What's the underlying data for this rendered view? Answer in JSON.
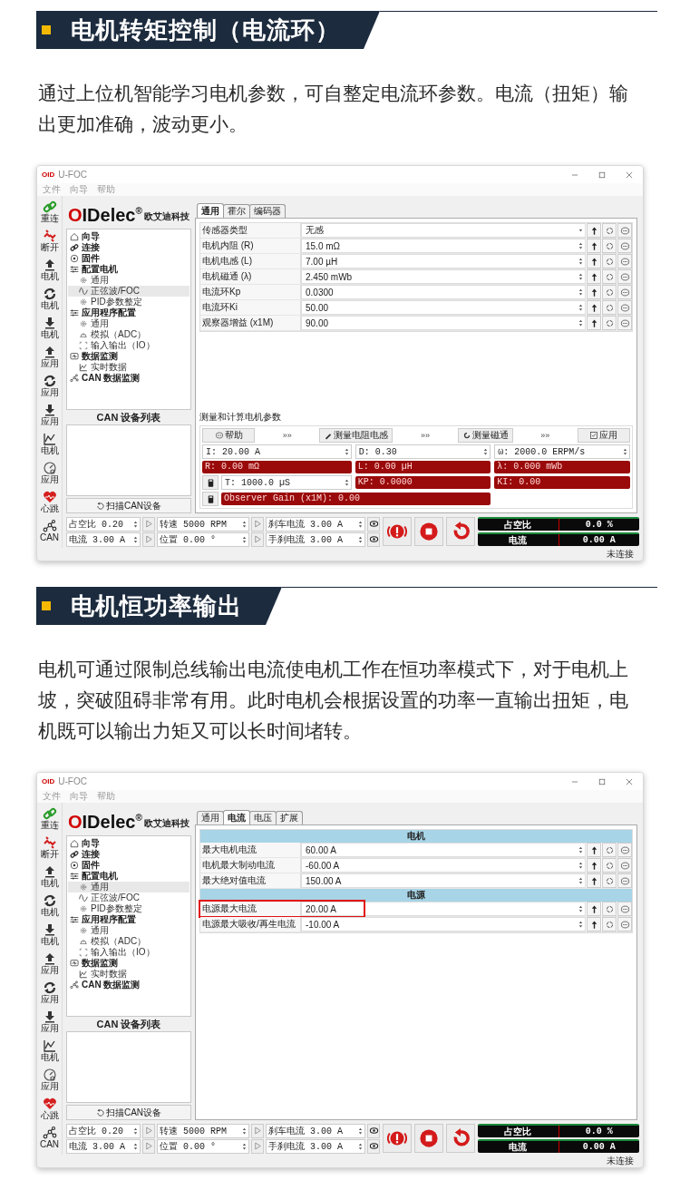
{
  "sections": [
    {
      "title": "电机转矩控制（电流环）",
      "paragraph": "通过上位机智能学习电机参数，可自整定电流环参数。电流（扭矩）输出更加准确，波动更小。",
      "app": {
        "badge": "OID",
        "title": "U-FOC",
        "menu": [
          "文件",
          "向导",
          "帮助"
        ],
        "toolbar": [
          {
            "kind": "connect",
            "label": "重连"
          },
          {
            "kind": "disconnect",
            "label": "断开"
          },
          {
            "kind": "upload",
            "label": "电机"
          },
          {
            "kind": "sync",
            "label": "电机"
          },
          {
            "kind": "download",
            "label": "电机"
          },
          {
            "kind": "upload",
            "label": "应用"
          },
          {
            "kind": "sync",
            "label": "应用"
          },
          {
            "kind": "download",
            "label": "应用"
          },
          {
            "kind": "chart",
            "label": "电机"
          },
          {
            "kind": "gauge",
            "label": "应用"
          },
          {
            "kind": "heart",
            "label": "心跳"
          },
          {
            "kind": "can",
            "label": "CAN"
          }
        ],
        "logo": {
          "accent": "O",
          "text": "IDelec",
          "mark": "®",
          "company": "欧艾迪科技"
        },
        "tree": [
          {
            "kind": "home",
            "label": "向导",
            "selected": false
          },
          {
            "kind": "link",
            "label": "连接",
            "selected": false
          },
          {
            "kind": "chip",
            "label": "固件",
            "selected": false
          },
          {
            "kind": "sliders",
            "label": "配置电机",
            "selected": false,
            "children": [
              {
                "kind": "gear",
                "label": "通用",
                "selected": false
              },
              {
                "kind": "wave",
                "label": "正弦波/FOC",
                "selected": true
              },
              {
                "kind": "pid",
                "label": "PID参数整定",
                "selected": false
              }
            ]
          },
          {
            "kind": "sliders",
            "label": "应用程序配置",
            "selected": false,
            "children": [
              {
                "kind": "gear",
                "label": "通用",
                "selected": false
              },
              {
                "kind": "analog",
                "label": "模拟（ADC）",
                "selected": false
              },
              {
                "kind": "io",
                "label": "输入输出（IO）",
                "selected": false
              }
            ]
          },
          {
            "kind": "monitor",
            "label": "数据监测",
            "selected": false,
            "children": [
              {
                "kind": "chart",
                "label": "实时数据",
                "selected": false
              }
            ]
          },
          {
            "kind": "can",
            "label": "CAN 数据监测",
            "selected": false
          }
        ],
        "can_list_title": "CAN 设备列表",
        "scan_button": "扫描CAN设备",
        "tabs": [
          {
            "label": "通用",
            "selected": true
          },
          {
            "label": "霍尔",
            "selected": false
          },
          {
            "label": "编码器",
            "selected": false
          }
        ],
        "rows": [
          {
            "kind": "dropdown",
            "label": "传感器类型",
            "value": "无感",
            "highlighted": false
          },
          {
            "kind": "spin",
            "label": "电机内阻 (R)",
            "value": "15.0 mΩ",
            "highlighted": false
          },
          {
            "kind": "spin",
            "label": "电机电感 (L)",
            "value": "7.00 µH",
            "highlighted": false
          },
          {
            "kind": "spin",
            "label": "电机磁通 (λ)",
            "value": "2.450 mWb",
            "highlighted": false
          },
          {
            "kind": "spin",
            "label": "电流环Kp",
            "value": "0.0300",
            "highlighted": false
          },
          {
            "kind": "spin",
            "label": "电流环Ki",
            "value": "50.00",
            "highlighted": false
          },
          {
            "kind": "spin",
            "label": "观察器增益 (x1M)",
            "value": "90.00",
            "highlighted": false
          }
        ],
        "measure": {
          "title": "测量和计算电机参数",
          "actions": [
            {
              "kind": "help",
              "label": "帮助"
            },
            {
              "kind": "arrow",
              "label": "»»"
            },
            {
              "kind": "measure_rl",
              "label": "测量电阻电感"
            },
            {
              "kind": "arrow",
              "label": "»»"
            },
            {
              "kind": "measure_flux",
              "label": "测量磁通"
            },
            {
              "kind": "arrow",
              "label": "»»"
            },
            {
              "kind": "apply",
              "label": "应用"
            }
          ],
          "rows": [
            [
              {
                "kind": "input",
                "text": "I: 20.00 A"
              },
              {
                "kind": "input",
                "text": "D: 0.30"
              },
              {
                "kind": "input",
                "text": "ω: 2000.0 ERPM/s"
              }
            ],
            [
              {
                "kind": "result",
                "text": "R: 0.00 mΩ"
              },
              {
                "kind": "result",
                "text": "L: 0.00 µH"
              },
              {
                "kind": "result",
                "text": "λ: 0.000 mWb"
              }
            ],
            [
              {
                "kind": "input",
                "text": "T: 1000.0 µS",
                "calculator": true
              },
              {
                "kind": "result",
                "text": "KP: 0.0000"
              },
              {
                "kind": "result",
                "text": "KI: 0.00"
              }
            ],
            [
              {
                "kind": "result",
                "text": "Observer Gain (x1M): 0.00",
                "calculator": true
              }
            ]
          ]
        },
        "controls": [
          {
            "text": "占空比 0.20",
            "kind": "play"
          },
          {
            "text": "转速 5000 RPM",
            "kind": "play"
          },
          {
            "text": "刹车电流 3.00 A",
            "kind": "view"
          },
          {
            "text": "电流 3.00 A",
            "kind": "play"
          },
          {
            "text": "位置 0.00 °",
            "kind": "play"
          },
          {
            "text": "手刹电流 3.00 A",
            "kind": "view"
          }
        ],
        "big_buttons": [
          {
            "kind": "alarm"
          },
          {
            "kind": "stop"
          },
          {
            "kind": "reset"
          }
        ],
        "meters": [
          {
            "label": "占空比",
            "reading": "0.0 %"
          },
          {
            "label": "电流",
            "reading": "0.00 A"
          }
        ],
        "status": "未连接"
      }
    },
    {
      "title": "电机恒功率输出",
      "paragraph": "电机可通过限制总线输出电流使电机工作在恒功率模式下，对于电机上坡，突破阻碍非常有用。此时电机会根据设置的功率一直输出扭矩，电机既可以输出力矩又可以长时间堵转。",
      "app": {
        "badge": "OID",
        "title": "U-FOC",
        "menu": [
          "文件",
          "向导",
          "帮助"
        ],
        "toolbar": [
          {
            "kind": "connect",
            "label": "重连"
          },
          {
            "kind": "disconnect",
            "label": "断开"
          },
          {
            "kind": "upload",
            "label": "电机"
          },
          {
            "kind": "sync",
            "label": "电机"
          },
          {
            "kind": "download",
            "label": "电机"
          },
          {
            "kind": "upload",
            "label": "应用"
          },
          {
            "kind": "sync",
            "label": "应用"
          },
          {
            "kind": "download",
            "label": "应用"
          },
          {
            "kind": "chart",
            "label": "电机"
          },
          {
            "kind": "gauge",
            "label": "应用"
          },
          {
            "kind": "heart",
            "label": "心跳"
          },
          {
            "kind": "can",
            "label": "CAN"
          }
        ],
        "logo": {
          "accent": "O",
          "text": "IDelec",
          "mark": "®",
          "company": "欧艾迪科技"
        },
        "tree": [
          {
            "kind": "home",
            "label": "向导",
            "selected": false
          },
          {
            "kind": "link",
            "label": "连接",
            "selected": false
          },
          {
            "kind": "chip",
            "label": "固件",
            "selected": false
          },
          {
            "kind": "sliders",
            "label": "配置电机",
            "selected": false,
            "children": [
              {
                "kind": "gear",
                "label": "通用",
                "selected": true
              },
              {
                "kind": "wave",
                "label": "正弦波/FOC",
                "selected": false
              },
              {
                "kind": "pid",
                "label": "PID参数整定",
                "selected": false
              }
            ]
          },
          {
            "kind": "sliders",
            "label": "应用程序配置",
            "selected": false,
            "children": [
              {
                "kind": "gear",
                "label": "通用",
                "selected": false
              },
              {
                "kind": "analog",
                "label": "模拟（ADC）",
                "selected": false
              },
              {
                "kind": "io",
                "label": "输入输出（IO）",
                "selected": false
              }
            ]
          },
          {
            "kind": "monitor",
            "label": "数据监测",
            "selected": false,
            "children": [
              {
                "kind": "chart",
                "label": "实时数据",
                "selected": false
              }
            ]
          },
          {
            "kind": "can",
            "label": "CAN 数据监测",
            "selected": false
          }
        ],
        "can_list_title": "CAN 设备列表",
        "scan_button": "扫描CAN设备",
        "tabs": [
          {
            "label": "通用",
            "selected": false
          },
          {
            "label": "电流",
            "selected": true
          },
          {
            "label": "电压",
            "selected": false
          },
          {
            "label": "扩展",
            "selected": false
          }
        ],
        "rows": [
          {
            "kind": "group",
            "label": "电机"
          },
          {
            "kind": "spin",
            "label": "最大电机电流",
            "value": "60.00 A",
            "highlighted": false
          },
          {
            "kind": "spin",
            "label": "电机最大制动电流",
            "value": "-60.00 A",
            "highlighted": false
          },
          {
            "kind": "spin",
            "label": "最大绝对值电流",
            "value": "150.00 A",
            "highlighted": false
          },
          {
            "kind": "group",
            "label": "电源"
          },
          {
            "kind": "spin",
            "label": "电源最大电流",
            "value": "20.00 A",
            "highlighted": true
          },
          {
            "kind": "spin",
            "label": "电源最大吸收/再生电流",
            "value": "-10.00 A",
            "highlighted": false
          }
        ],
        "controls": [
          {
            "text": "占空比 0.20",
            "kind": "play"
          },
          {
            "text": "转速 5000 RPM",
            "kind": "play"
          },
          {
            "text": "刹车电流 3.00 A",
            "kind": "view"
          },
          {
            "text": "电流 3.00 A",
            "kind": "play"
          },
          {
            "text": "位置 0.00 °",
            "kind": "play"
          },
          {
            "text": "手刹电流 3.00 A",
            "kind": "view"
          }
        ],
        "big_buttons": [
          {
            "kind": "alarm"
          },
          {
            "kind": "stop"
          },
          {
            "kind": "reset"
          }
        ],
        "meters": [
          {
            "label": "占空比",
            "reading": "0.0 %"
          },
          {
            "label": "电流",
            "reading": "0.00 A"
          }
        ],
        "status": "未连接"
      }
    }
  ]
}
